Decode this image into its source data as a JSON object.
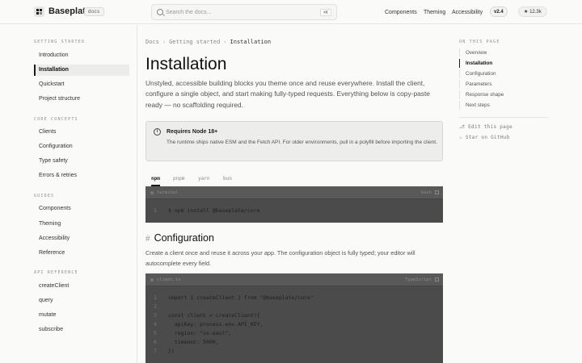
{
  "header": {
    "brand": "Baseplate",
    "brand_badge": "docs",
    "search_placeholder": "Search the docs...",
    "search_shortcut": "⌘K",
    "nav": [
      "Components",
      "Theming",
      "Accessibility"
    ],
    "version": "v2.4",
    "stars": "12.3k"
  },
  "sidebar": {
    "sections": [
      {
        "title": "GETTING STARTED",
        "items": [
          "Introduction",
          "Installation",
          "Quickstart",
          "Project structure"
        ]
      },
      {
        "title": "CORE CONCEPTS",
        "items": [
          "Clients",
          "Configuration",
          "Type safety",
          "Errors & retries"
        ]
      },
      {
        "title": "GUIDES",
        "items": [
          "Components",
          "Theming",
          "Accessibility",
          "Reference"
        ]
      },
      {
        "title": "API REFERENCE",
        "items": [
          "createClient",
          "query",
          "mutate",
          "subscribe"
        ]
      }
    ],
    "active_item": "Installation"
  },
  "main": {
    "breadcrumb": [
      "Docs",
      "Getting started",
      "Installation"
    ],
    "title": "Installation",
    "lead": "Unstyled, accessible building blocks you theme once and reuse everywhere. Install the client, configure a single object, and start making fully-typed requests. Everything below is copy-paste ready — no scaffolding required.",
    "callout": {
      "icon": "i",
      "title": "Requires Node 18+",
      "body": "The runtime ships native ESM and the Fetch API. For older environments, pull in a polyfill before importing the client."
    },
    "install_tabs": [
      "npm",
      "pnpm",
      "yarn",
      "bun"
    ],
    "install_active_tab": "npm",
    "install_code": {
      "label": "terminal",
      "right": "bash",
      "lines": [
        {
          "num": "1",
          "text": "$ npm install @baseplate/core"
        }
      ]
    },
    "section_title": "Configuration",
    "section_text": "Create a client once and reuse it across your app. The configuration object is fully typed; your editor will autocomplete every field.",
    "config_code": {
      "label": "client.ts",
      "right": "TypeScript",
      "lines": [
        {
          "num": "1",
          "text": "import { createClient } from \"@baseplate/core\""
        },
        {
          "num": "2",
          "text": ""
        },
        {
          "num": "3",
          "text": "const client = createClient({"
        },
        {
          "num": "4",
          "text": "  apiKey: process.env.API_KEY,"
        },
        {
          "num": "5",
          "text": "  region: \"us-east\","
        },
        {
          "num": "6",
          "text": "  timeout: 5000,"
        },
        {
          "num": "7",
          "text": "})"
        }
      ]
    }
  },
  "toc": {
    "title": "ON THIS PAGE",
    "items": [
      "Overview",
      "Installation",
      "Configuration",
      "Parameters",
      "Response shape",
      "Next steps"
    ],
    "active_item": "Installation",
    "links": [
      {
        "icon": "branch-icon",
        "label": "Edit this page"
      },
      {
        "icon": "star-icon",
        "label": "Star on GitHub"
      }
    ]
  }
}
